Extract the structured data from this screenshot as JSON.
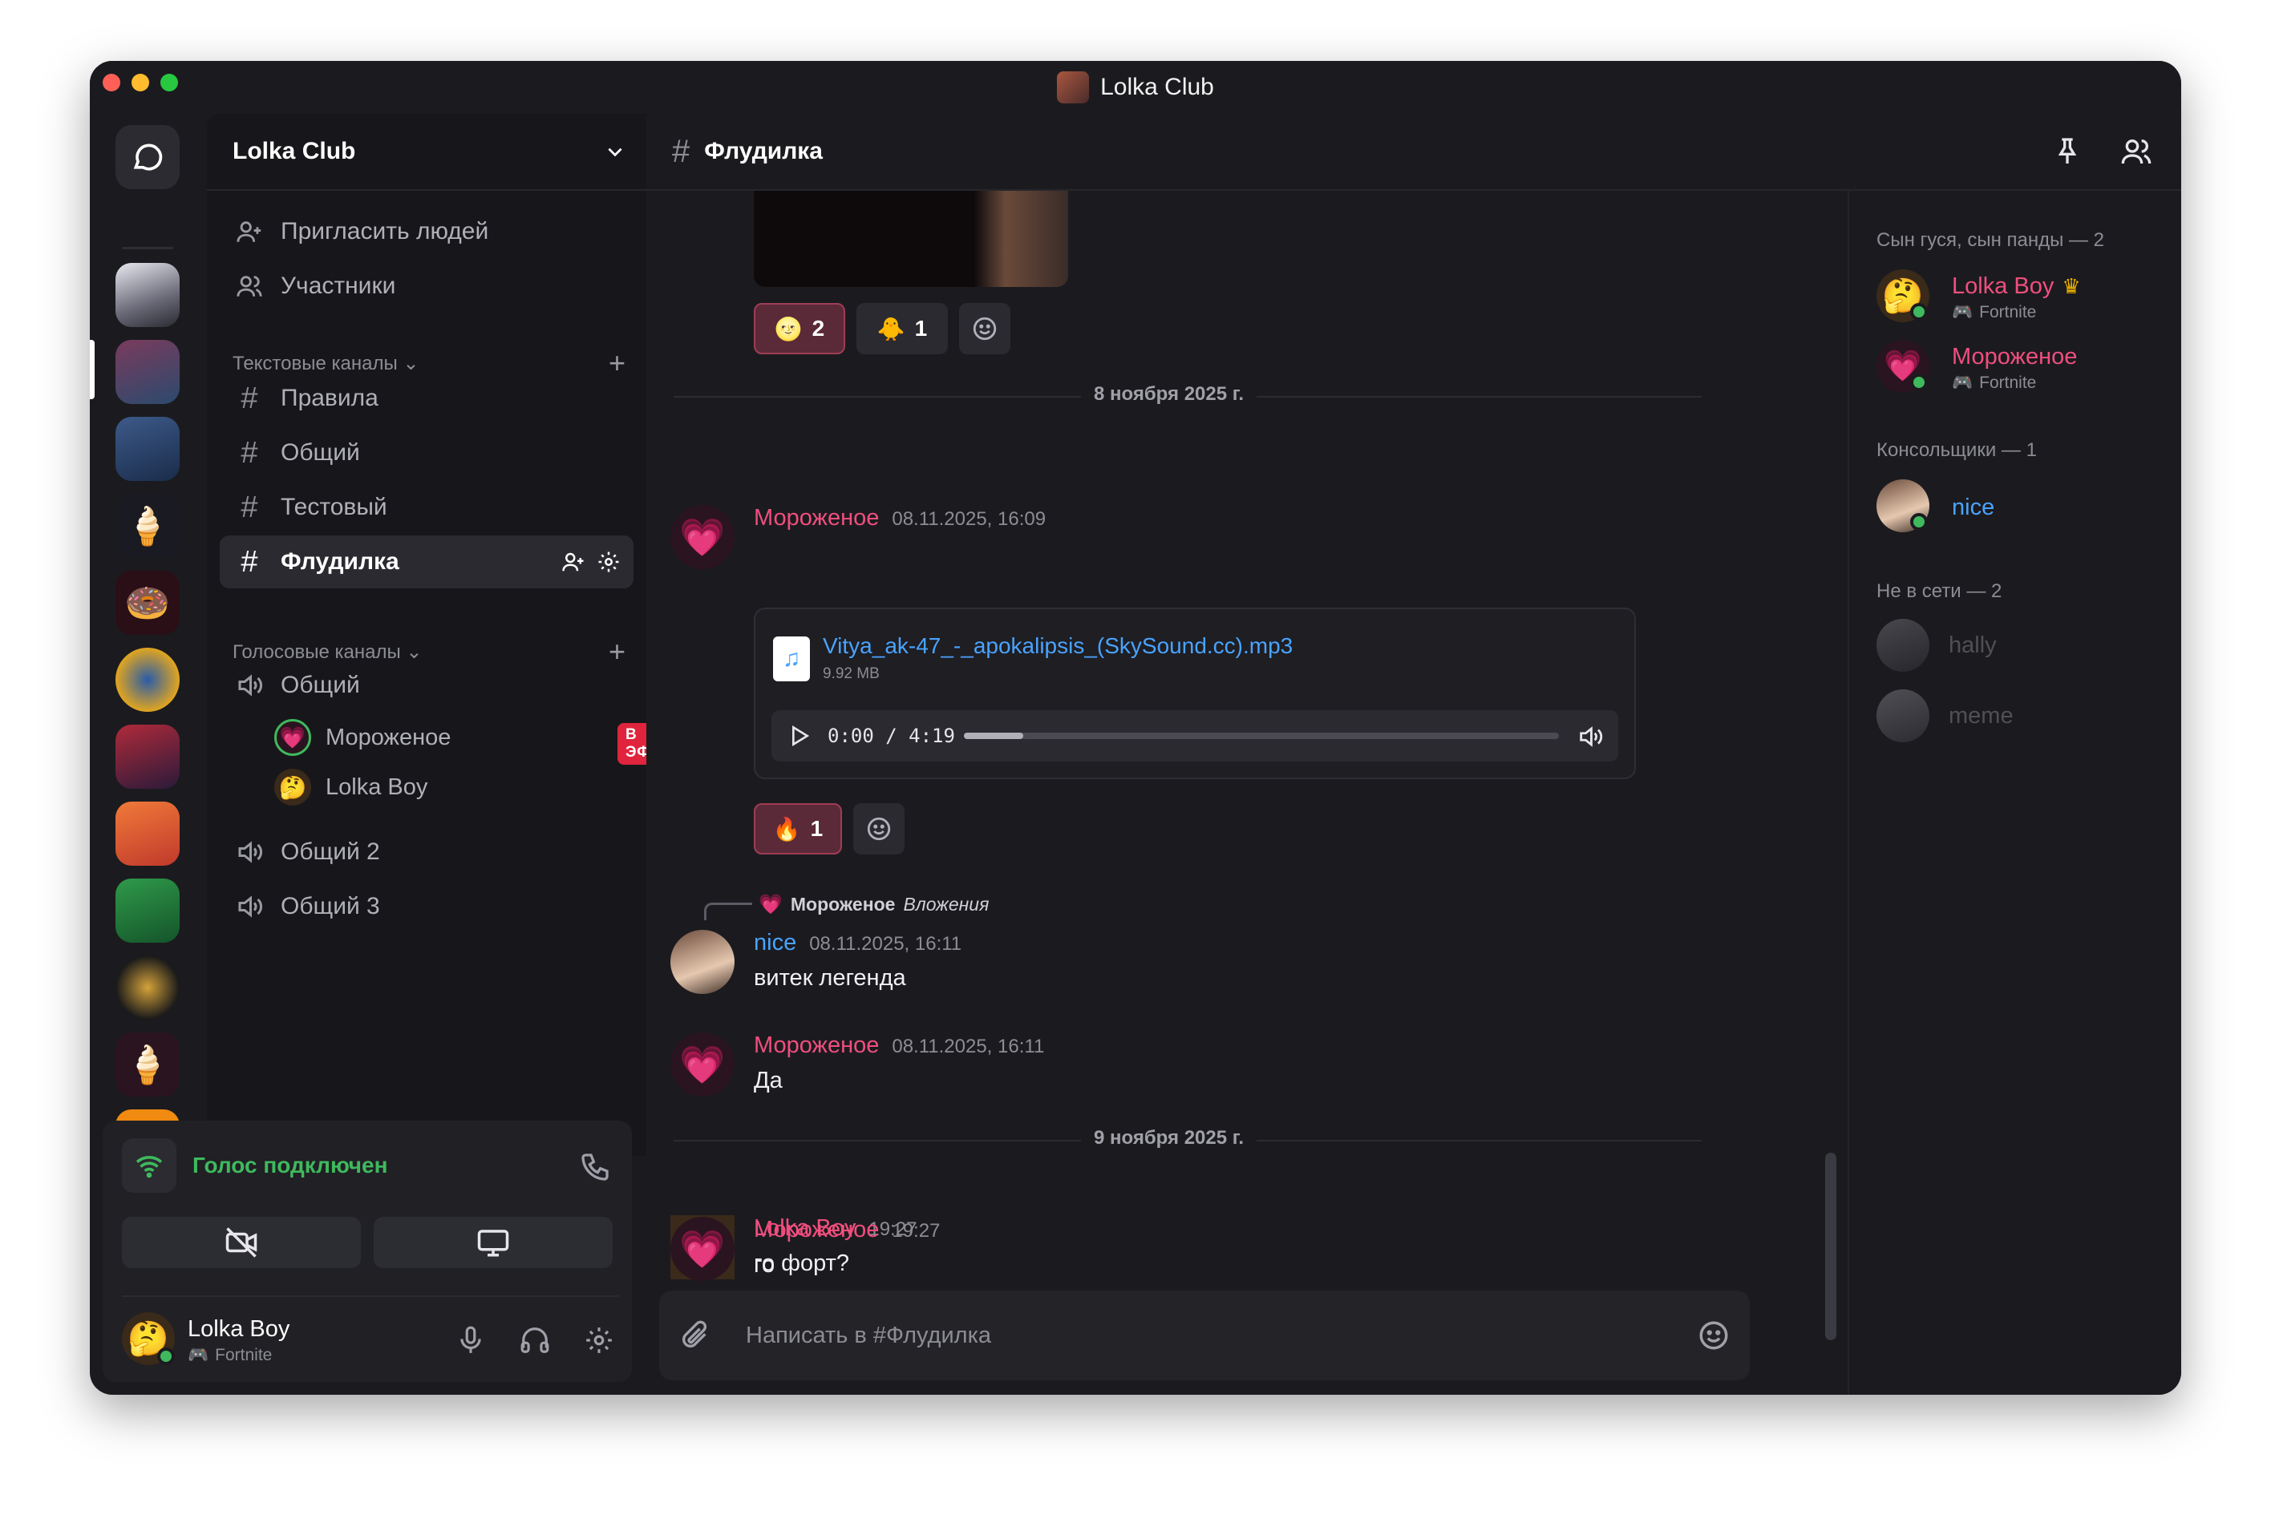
{
  "window": {
    "title": "Lolka Club"
  },
  "server": {
    "name": "Lolka Club"
  },
  "sidebar": {
    "actions": [
      {
        "label": "Пригласить людей",
        "icon": "user-plus-icon"
      },
      {
        "label": "Участники",
        "icon": "users-icon"
      }
    ],
    "text_section": "Текстовые каналы",
    "text_channels": [
      {
        "label": "Правила"
      },
      {
        "label": "Общий"
      },
      {
        "label": "Тестовый"
      },
      {
        "label": "Флудилка",
        "active": true
      }
    ],
    "voice_section": "Голосовые каналы",
    "voice_channels": [
      {
        "label": "Общий"
      },
      {
        "label": "Общий 2"
      },
      {
        "label": "Общий 3"
      }
    ],
    "voice_users": [
      {
        "name": "Мороженое",
        "badge": "В ЭФИРЕ"
      },
      {
        "name": "Lolka Boy"
      }
    ]
  },
  "voice_panel": {
    "status": "Голос подключен",
    "user": {
      "name": "Lolka Boy",
      "activity": "Fortnite"
    }
  },
  "channel": {
    "name": "Флудилка"
  },
  "messages": {
    "reactions_top": [
      {
        "emoji": "🌝",
        "count": "2"
      },
      {
        "emoji": "🐥",
        "count": "1"
      }
    ],
    "divider1": "8 ноября 2025 г.",
    "m1": {
      "author": "Мороженое",
      "time": "08.11.2025, 16:09",
      "file": {
        "name": "Vitya_ak-47_-_apokalipsis_(SkySound.cc).mp3",
        "size": "9.92 MB",
        "time": "0:00 / 4:19",
        "progress": 0.1
      },
      "reaction": {
        "emoji": "🔥",
        "count": "1"
      }
    },
    "m2": {
      "reply_author": "Мороженое",
      "reply_text": "Вложения",
      "author": "nice",
      "time": "08.11.2025, 16:11",
      "text": "витек легенда"
    },
    "m3": {
      "author": "Мороженое",
      "time": "08.11.2025, 16:11",
      "text": "Да"
    },
    "divider2": "9 ноября 2025 г.",
    "m4": {
      "author": "Lolka Boy",
      "time": "19:27",
      "text": "го форт?"
    },
    "m5": {
      "author": "Мороженое",
      "time": "19:27",
      "text": "го"
    }
  },
  "composer": {
    "placeholder": "Написать в #Флудилка"
  },
  "members": {
    "group1": "Сын гуся, сын панды — 2",
    "g1": [
      {
        "name": "Lolka Boy",
        "activity": "Fortnite",
        "crown": true
      },
      {
        "name": "Мороженое",
        "activity": "Fortnite"
      }
    ],
    "group2": "Консольщики — 1",
    "g2": [
      {
        "name": "nice"
      }
    ],
    "group3": "Не в сети — 2",
    "g3": [
      {
        "name": "hally"
      },
      {
        "name": "meme"
      }
    ]
  },
  "colors": {
    "accent": "#f04e7e",
    "link": "#4aa3ff",
    "online": "#3fb95d",
    "live": "#e0243d"
  }
}
